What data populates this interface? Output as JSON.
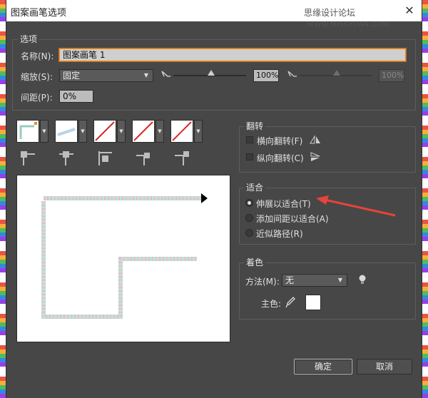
{
  "window": {
    "title": "图案画笔选项",
    "watermark": "思缘设计论坛",
    "watermark_site": "WWW.MISSYUAN.COM"
  },
  "options": {
    "group_title": "选项",
    "name_label": "名称(N):",
    "name_value": "图案画笔 1",
    "scale_label": "缩放(S):",
    "scale_value": "固定",
    "scale_pct_1": "100%",
    "scale_pct_2": "100%",
    "spacing_label": "间距(P):",
    "spacing_value": "0%"
  },
  "flip": {
    "group_title": "翻转",
    "horizontal_label": "横向翻转(F)",
    "vertical_label": "纵向翻转(C)"
  },
  "fit": {
    "group_title": "适合",
    "options": [
      "伸展以适合(T)",
      "添加间距以适合(A)",
      "近似路径(R)"
    ],
    "selected_index": 0
  },
  "colorization": {
    "group_title": "着色",
    "method_label": "方法(M):",
    "method_value": "无",
    "key_color_label": "主色:",
    "key_color": "#ffffff"
  },
  "buttons": {
    "ok": "确定",
    "cancel": "取消"
  },
  "colors": {
    "dialog_bg": "#474747",
    "accent_arrow": "#e8433a",
    "focus_border": "#e88a2a"
  },
  "icons": {
    "close": "close-icon",
    "pen_tool": "pen-scale-icon",
    "flip_horizontal": "flip-horizontal-icon",
    "flip_vertical": "flip-vertical-icon",
    "tips": "lightbulb-icon",
    "eyedropper": "eyedropper-icon"
  }
}
